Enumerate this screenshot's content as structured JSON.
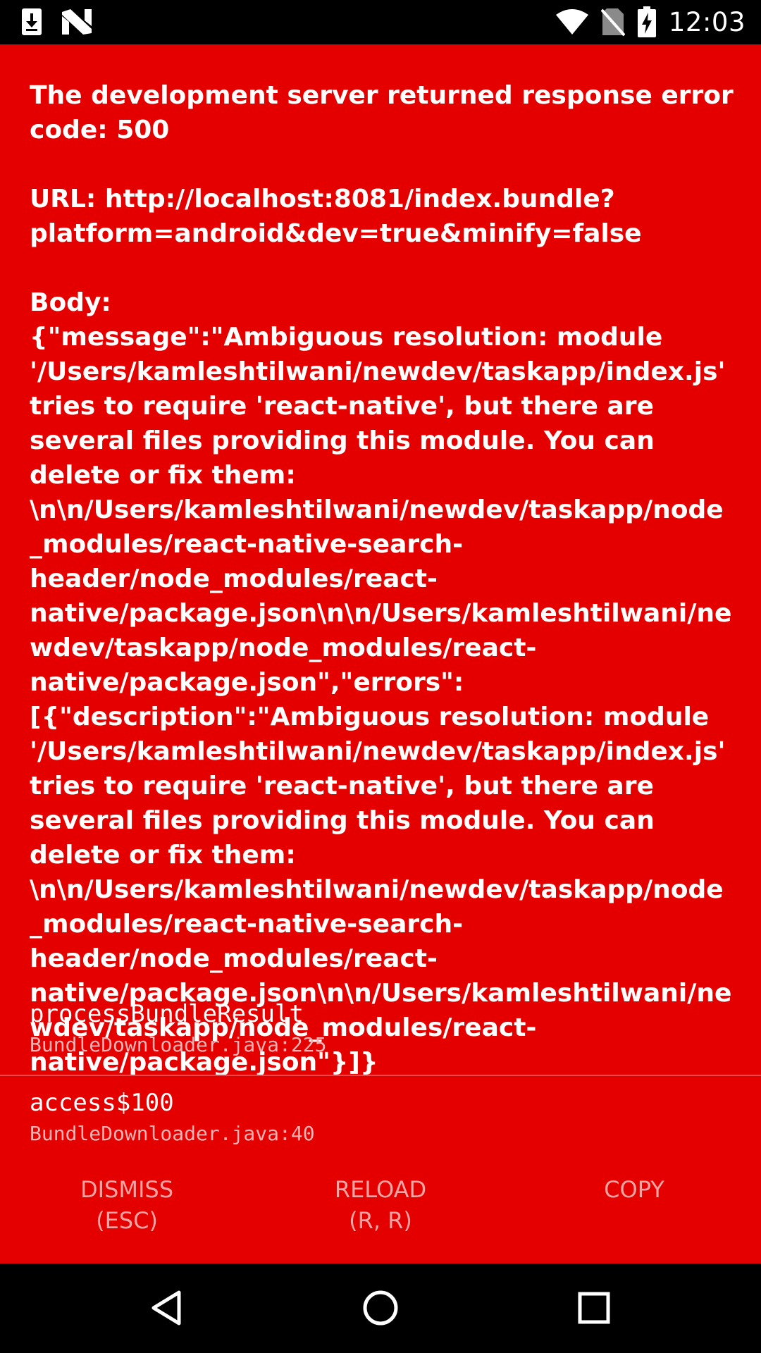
{
  "status_bar": {
    "time": "12:03",
    "icons_left": [
      "download-icon",
      "n-notification-icon"
    ],
    "icons_right": [
      "wifi-icon",
      "no-sim-icon",
      "battery-charging-icon"
    ]
  },
  "error": {
    "background_color": "#e50000",
    "message": "The development server returned response error code: 500\n\nURL: http://localhost:8081/index.bundle?platform=android&dev=true&minify=false\n\nBody:\n{\"message\":\"Ambiguous resolution: module '/Users/kamleshtilwani/newdev/taskapp/index.js' tries to require 'react-native', but there are several files providing this module. You can delete or fix them: \\n\\n/Users/kamleshtilwani/newdev/taskapp/node_modules/react-native-search-header/node_modules/react-native/package.json\\n\\n/Users/kamleshtilwani/newdev/taskapp/node_modules/react-native/package.json\",\"errors\":[{\"description\":\"Ambiguous resolution: module '/Users/kamleshtilwani/newdev/taskapp/index.js' tries to require 'react-native', but there are several files providing this module. You can delete or fix them: \\n\\n/Users/kamleshtilwani/newdev/taskapp/node_modules/react-native-search-header/node_modules/react-native/package.json\\n\\n/Users/kamleshtilwani/newdev/taskapp/node_modules/react-native/package.json\"}]}",
    "stack": [
      {
        "method": "processBundleResult",
        "file": "BundleDownloader.java:225"
      },
      {
        "method": "access$100",
        "file": "BundleDownloader.java:40"
      }
    ]
  },
  "buttons": {
    "dismiss": {
      "line1": "DISMISS",
      "line2": "(ESC)"
    },
    "reload": {
      "line1": "RELOAD",
      "line2": "(R, R)"
    },
    "copy": {
      "line1": "COPY"
    }
  },
  "nav_bar": {
    "icons": [
      "back-icon",
      "home-icon",
      "recents-icon"
    ]
  }
}
